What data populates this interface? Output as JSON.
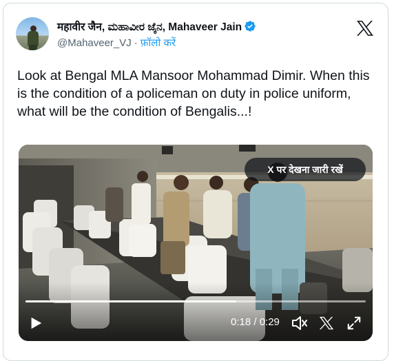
{
  "author": {
    "display_name": "महावीर जैन, ಮಹಾವೀರ ಜೈನ, Mahaveer Jain",
    "handle": "@Mahaveer_VJ",
    "separator": "·",
    "follow_label": "फ़ॉलो करें",
    "verified_icon": "verified-badge-icon",
    "verified_color": "#1d9bf0"
  },
  "platform_logo": "x-logo-icon",
  "tweet": {
    "text": "Look at Bengal MLA Mansoor Mohammad Dimir. When this is the condition of a policeman on duty in police uniform, what will be the condition of Bengalis...!"
  },
  "video": {
    "continue_label": "X पर देखना जारी रखें",
    "time_display": "0:18 / 0:29",
    "progress": 0.62,
    "play_icon": "play-icon",
    "volume_icon": "volume-icon",
    "x_icon": "x-icon",
    "fullscreen_icon": "expand-icon"
  },
  "colors": {
    "link": "#1d9bf0",
    "text": "#0f1419",
    "secondary_text": "#536471",
    "border": "#cfd9de"
  }
}
